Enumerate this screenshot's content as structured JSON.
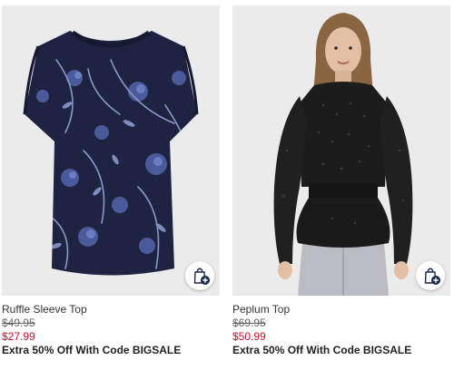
{
  "products": [
    {
      "name": "Ruffle Sleeve Top",
      "original_price": "$49.95",
      "sale_price": "$27.99",
      "promo": "Extra 50% Off With Code BIGSALE",
      "image_icon": "navy-floral-blouse-image"
    },
    {
      "name": "Peplum Top",
      "original_price": "$69.95",
      "sale_price": "$50.99",
      "promo": "Extra 50% Off With Code BIGSALE",
      "image_icon": "model-in-black-peplum-top-image"
    }
  ],
  "actions": {
    "add_to_bag_icon": "shopping-bag-plus-icon"
  },
  "colors": {
    "sale_price": "#c8102e",
    "image_background": "#ebebeb",
    "bag_icon_navy": "#1b2a4a"
  }
}
